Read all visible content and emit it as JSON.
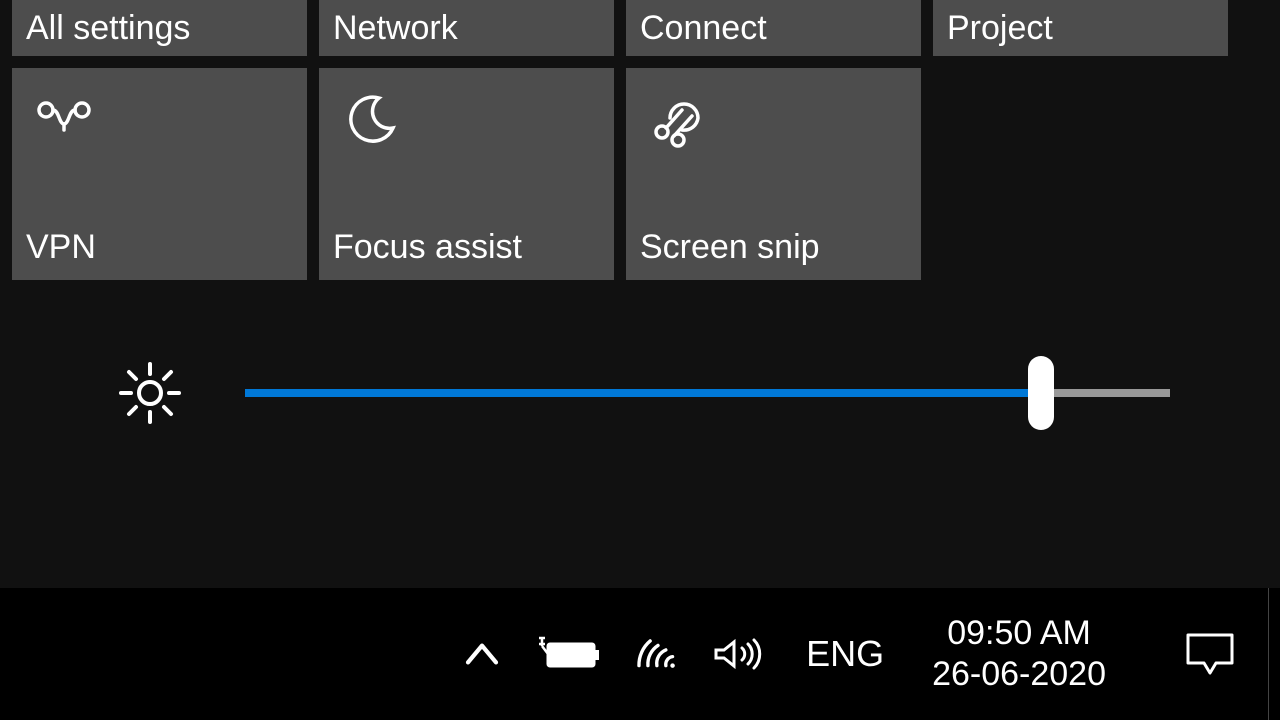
{
  "tiles": {
    "row1": {
      "all_settings": "All settings",
      "network": "Network",
      "connect": "Connect",
      "project": "Project"
    },
    "row2": {
      "vpn": "VPN",
      "focus_assist": "Focus assist",
      "screen_snip": "Screen snip"
    }
  },
  "brightness": {
    "percent": 86
  },
  "taskbar": {
    "language": "ENG",
    "time": "09:50 AM",
    "date": "26-06-2020"
  }
}
